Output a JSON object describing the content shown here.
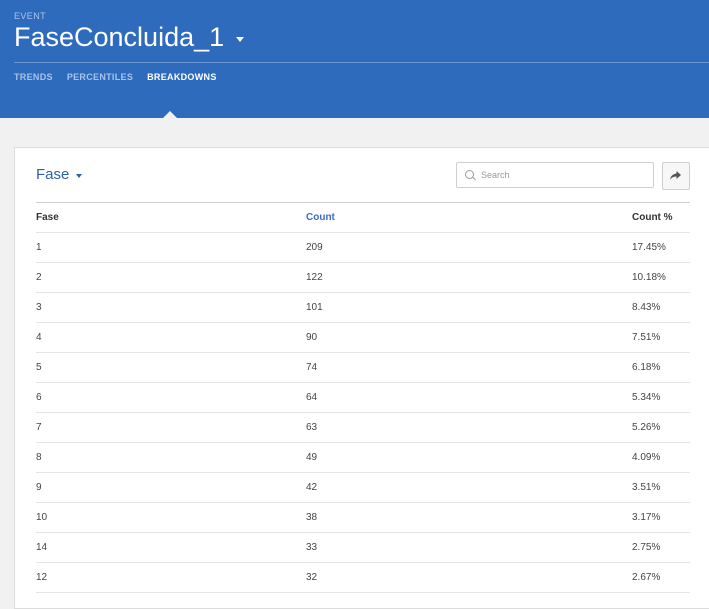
{
  "header": {
    "event_label": "EVENT",
    "title": "FaseConcluida_1",
    "tabs": [
      {
        "label": "TRENDS",
        "active": false
      },
      {
        "label": "PERCENTILES",
        "active": false
      },
      {
        "label": "BREAKDOWNS",
        "active": true
      }
    ]
  },
  "card": {
    "group_by": "Fase",
    "search": {
      "placeholder": "Search",
      "value": ""
    },
    "share_icon": "share-arrow-icon"
  },
  "table": {
    "columns": [
      "Fase",
      "Count",
      "Count %"
    ],
    "sorted_column": "Count",
    "rows": [
      {
        "fase": "1",
        "count": "209",
        "pct": "17.45%"
      },
      {
        "fase": "2",
        "count": "122",
        "pct": "10.18%"
      },
      {
        "fase": "3",
        "count": "101",
        "pct": "8.43%"
      },
      {
        "fase": "4",
        "count": "90",
        "pct": "7.51%"
      },
      {
        "fase": "5",
        "count": "74",
        "pct": "6.18%"
      },
      {
        "fase": "6",
        "count": "64",
        "pct": "5.34%"
      },
      {
        "fase": "7",
        "count": "63",
        "pct": "5.26%"
      },
      {
        "fase": "8",
        "count": "49",
        "pct": "4.09%"
      },
      {
        "fase": "9",
        "count": "42",
        "pct": "3.51%"
      },
      {
        "fase": "10",
        "count": "38",
        "pct": "3.17%"
      },
      {
        "fase": "14",
        "count": "33",
        "pct": "2.75%"
      },
      {
        "fase": "12",
        "count": "32",
        "pct": "2.67%"
      }
    ]
  },
  "colors": {
    "header_bg": "#2f6bbd",
    "accent": "#3d6cc4",
    "page_bg": "#f1f1f1"
  }
}
